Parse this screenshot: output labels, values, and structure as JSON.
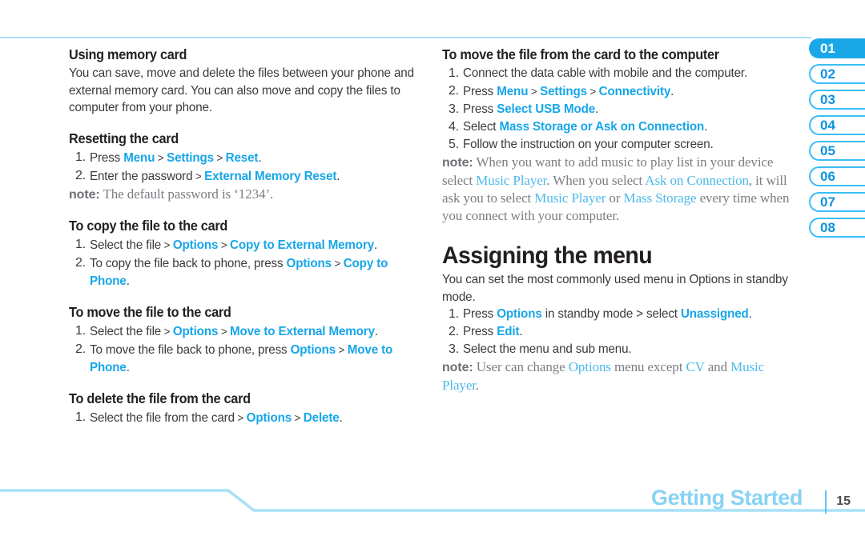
{
  "document": {
    "footer_title": "Getting Started",
    "page_number": "15",
    "accent_blue": "#17a6e8",
    "tab_blue": "#1aa7e8",
    "rule_blue": "#a9e0f7",
    "note_gray": "#7a7d82"
  },
  "side_tabs": [
    {
      "label": "01",
      "active": true
    },
    {
      "label": "02",
      "active": false
    },
    {
      "label": "03",
      "active": false
    },
    {
      "label": "04",
      "active": false
    },
    {
      "label": "05",
      "active": false
    },
    {
      "label": "06",
      "active": false
    },
    {
      "label": "07",
      "active": false
    },
    {
      "label": "08",
      "active": false
    }
  ],
  "left_column": {
    "s1": {
      "heading": "Using memory card",
      "body": "You can save, move and delete the files between your phone and external memory card. You can also move and copy the files to computer from your phone."
    },
    "s2": {
      "heading": "Resetting the card",
      "step1_a": "Press ",
      "step1_l1": "Menu",
      "step1_g1": " > ",
      "step1_l2": "Settings",
      "step1_g2": " > ",
      "step1_l3": "Reset",
      "step1_end": ".",
      "step2_a": "Enter the password",
      "step2_g1": " > ",
      "step2_l1": "External Memory Reset",
      "step2_end": ".",
      "note_label": "note:",
      "note_text": " The default password is ‘1234’."
    },
    "s3": {
      "heading": "To copy the file to the card",
      "step1_a": "Select the file",
      "step1_g1": " > ",
      "step1_l1": "Options",
      "step1_g2": " > ",
      "step1_l2": "Copy to External Memory",
      "step1_end": ".",
      "step2_a": "To copy the file back to phone, press ",
      "step2_l1": "Options",
      "step2_g1": " > ",
      "step2_l2": "Copy to Phone",
      "step2_end": "."
    },
    "s4": {
      "heading": "To move the file to the card",
      "step1_a": "Select the file",
      "step1_g1": " > ",
      "step1_l1": "Options",
      "step1_g2": " > ",
      "step1_l2": "Move to External Memory",
      "step1_end": ".",
      "step2_a": "To move the file back to phone, press ",
      "step2_l1": "Options",
      "step2_g1": " > ",
      "step2_l2": "Move to Phone",
      "step2_end": "."
    },
    "s5": {
      "heading": "To delete the file from the card",
      "step1_a": "Select the file from the card",
      "step1_g1": " > ",
      "step1_l1": "Options",
      "step1_g2": " > ",
      "step1_l2": "Delete",
      "step1_end": "."
    }
  },
  "right_column": {
    "s1": {
      "heading": "To move the file from the card to the computer",
      "step1": "Connect the data cable with mobile and the computer.",
      "step2_a": "Press ",
      "step2_l1": "Menu",
      "step2_g1": " > ",
      "step2_l2": "Settings",
      "step2_g2": " > ",
      "step2_l3": "Connectivity",
      "step2_end": ".",
      "step3_a": "Press ",
      "step3_l1": "Select USB Mode",
      "step3_end": ".",
      "step4_a": "Select ",
      "step4_l1": "Mass Storage or Ask on Connection",
      "step4_end": ".",
      "step5": "Follow the instruction on your computer screen.",
      "note_label": "note:",
      "note_p1": " When you want to add music to play list in your device select ",
      "note_l1": "Music Player",
      "note_p2": ".  When you select ",
      "note_l2": "Ask on Connection",
      "note_p3": ", it will ask you to select ",
      "note_l3": "Music Player",
      "note_p4": " or ",
      "note_l4": "Mass Storage",
      "note_p5": " every time when you connect with your computer."
    },
    "s2": {
      "heading": "Assigning the menu",
      "body": "You can set the most commonly used menu in Options in standby mode.",
      "step1_a": "Press ",
      "step1_l1": "Options",
      "step1_mid": " in standby mode > select ",
      "step1_l2": "Unassigned",
      "step1_end": ".",
      "step2_a": "Press ",
      "step2_l1": "Edit",
      "step2_end": ".",
      "step3": "Select the menu and sub menu.",
      "note_label": "note:",
      "note_p1": " User can change ",
      "note_l1": "Options",
      "note_p2": " menu except ",
      "note_l2": "CV",
      "note_p3": " and ",
      "note_l3": "Music Player",
      "note_p4": "."
    }
  }
}
